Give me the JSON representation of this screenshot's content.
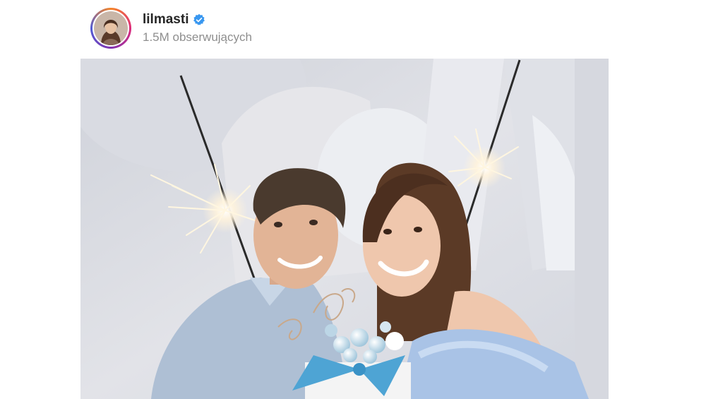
{
  "profile": {
    "username": "lilmasti",
    "verified": true,
    "followers_text": "1.5M obserwujących"
  },
  "post": {
    "media_type": "photo"
  },
  "colors": {
    "verified_badge": "#3897f0",
    "username": "#262626",
    "secondary_text": "#8e8e8e"
  },
  "icons": {
    "verified": "verified-badge-icon"
  }
}
